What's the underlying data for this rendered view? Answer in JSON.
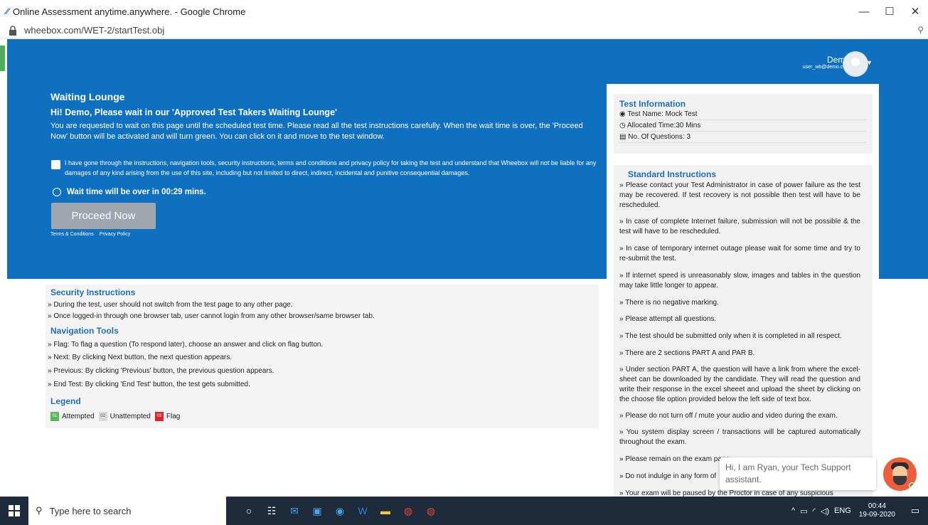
{
  "window": {
    "title": "Online Assessment anytime.anywhere. - Google Chrome",
    "minimize": "—",
    "maximize": "☐",
    "close": "✕"
  },
  "address": {
    "url": "wheebox.com/WET-2/startTest.obj"
  },
  "user": {
    "name": "Demo",
    "email": "user_wb@demo.com"
  },
  "lounge": {
    "title": "Waiting Lounge",
    "greeting": "Hi! Demo, Please wait in our 'Approved Test Takers Waiting Lounge'",
    "message": "You are requested to wait on this page until the scheduled test time. Please read all the test instructions carefully. When the wait time is over, the 'Proceed Now' button will be activated and will turn green. You can click on it and move to the test window.",
    "agreement": "I have gone through the instructions, navigation tools, security instructions, terms and conditions and privacy policy for taking the test and understand that Wheebox will not be liable for any damages of any kind arising from the use of this site, including but not limited to direct, indirect, incidental and punitive consequential damages.",
    "wait_text": "Wait time will be over in 00:29 mins.",
    "proceed_label": "Proceed Now",
    "terms_link": "Terms & Conditions",
    "privacy_link": "Privacy Policy"
  },
  "security": {
    "title": "Security Instructions",
    "items": [
      "» During the test, user should not switch from the test page to any other page.",
      "» Once logged-in through one browser tab, user cannot login from any other browser/same browser tab."
    ]
  },
  "navigation": {
    "title": "Navigation Tools",
    "items": [
      "» Flag: To flag a question (To respond later), choose an answer and click on flag button.",
      "» Next: By clicking Next button, the next question appears.",
      "» Previous: By clicking 'Previous' button, the previous question appears.",
      "» End Test: By clicking 'End Test' button, the test gets submitted."
    ]
  },
  "legend": {
    "title": "Legend",
    "items": [
      {
        "code": "01",
        "label": "Attempted",
        "color": "#5cb85c"
      },
      {
        "code": "02",
        "label": "Unattempted",
        "color": "#d9d9d9"
      },
      {
        "code": "03",
        "label": "Flag",
        "color": "#d9242f"
      }
    ]
  },
  "test_info": {
    "title": "Test Information",
    "name": "Test Name: Mock Test",
    "time": "Allocated Time:30 Mins",
    "questions": "No. Of Questions: 3"
  },
  "standard": {
    "title": "Standard Instructions",
    "items": [
      "» Please contact your Test Administrator in case of power failure as the test may be recovered. If test recovery is not possible then test will have to be rescheduled.",
      "» In case of complete Internet failure, submission will not be possible & the test will have to be rescheduled.",
      "» In case of temporary internet outage please wait for some time and try to re-submit the test.",
      "» If internet speed is unreasonably slow, images and tables in the question may take little longer to appear.",
      "» There is no negative marking.",
      "» Please attempt all questions.",
      "» The test should be submitted only when it is completed in all respect.",
      "» There are 2 sections PART A and PAR B.",
      "» Under section PART A, the question will have a link from where the excel-sheet can be downloaded by the candidate. They will read the question and write their response in the excel sheeet and upload the sheet by clicking on the choose file option provided below the left side of text box.",
      "» Please do not turn off / mute your audio and video during the exam.",
      "» You system display screen / transactions will be captured automatically throughout the exam.",
      "» Please remain on the exam page",
      "» Do not indulge in any form of",
      "» Your exam will be paused by the Proctor in case of any suspicious"
    ]
  },
  "chat": {
    "message": "Hi, I am Ryan, your Tech Support assistant."
  },
  "taskbar": {
    "search_placeholder": "Type here to search",
    "lang": "ENG",
    "time": "00:44",
    "date": "19-09-2020"
  }
}
